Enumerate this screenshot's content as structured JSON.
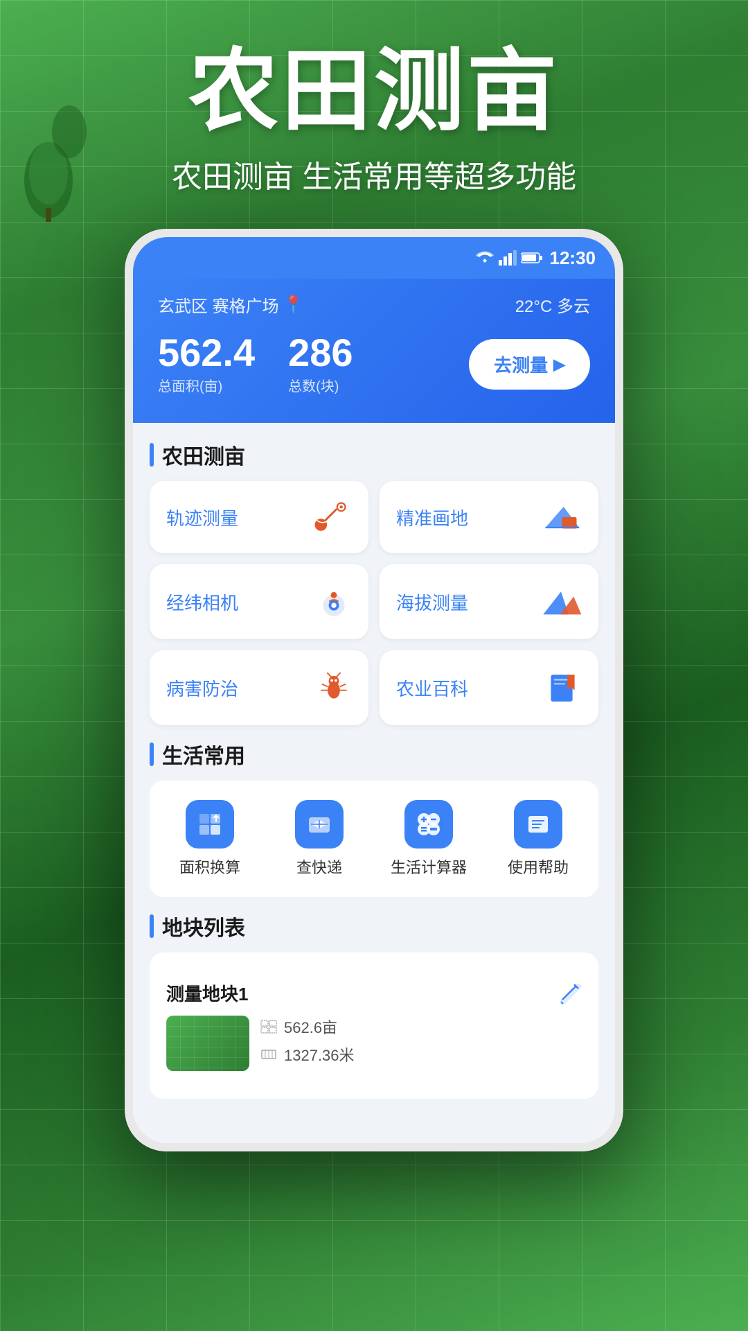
{
  "hero": {
    "title": "农田测亩",
    "subtitle": "农田测亩 生活常用等超多功能"
  },
  "statusBar": {
    "time": "12:30",
    "wifiIcon": "wifi",
    "signalIcon": "signal",
    "batteryIcon": "battery"
  },
  "header": {
    "location": "玄武区 赛格广场",
    "weather": "22°C  多云",
    "totalArea": "562.4",
    "totalAreaLabel": "总面积(亩)",
    "totalCount": "286",
    "totalCountLabel": "总数(块)",
    "measureBtn": "去测量"
  },
  "farmSection": {
    "title": "农田测亩",
    "features": [
      {
        "label": "轨迹测量",
        "icon": "track"
      },
      {
        "label": "精准画地",
        "icon": "draw"
      },
      {
        "label": "经纬相机",
        "icon": "camera"
      },
      {
        "label": "海拔测量",
        "icon": "altitude"
      },
      {
        "label": "病害防治",
        "icon": "pest"
      },
      {
        "label": "农业百科",
        "icon": "agri"
      }
    ]
  },
  "lifeSection": {
    "title": "生活常用",
    "tools": [
      {
        "label": "面积换算",
        "icon": "area"
      },
      {
        "label": "查快递",
        "icon": "express"
      },
      {
        "label": "生活计算器",
        "icon": "calc"
      },
      {
        "label": "使用帮助",
        "icon": "help"
      }
    ]
  },
  "plotSection": {
    "title": "地块列表",
    "plots": [
      {
        "name": "测量地块1",
        "area": "562.6亩",
        "perimeter": "1327.36米"
      }
    ]
  }
}
